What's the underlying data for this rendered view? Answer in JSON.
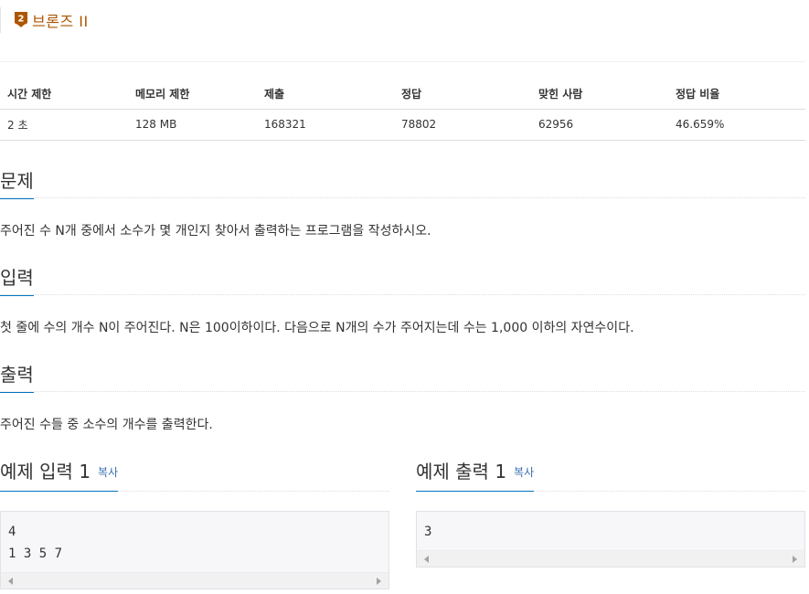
{
  "tier": {
    "number": "2",
    "label": "브론즈 II",
    "color": "#ad5600"
  },
  "info_table": {
    "headers": [
      "시간 제한",
      "메모리 제한",
      "제출",
      "정답",
      "맞힌 사람",
      "정답 비율"
    ],
    "values": [
      "2 초",
      "128 MB",
      "168321",
      "78802",
      "62956",
      "46.659%"
    ]
  },
  "sections": {
    "problem": {
      "title": "문제",
      "body": "주어진 수 N개 중에서 소수가 몇 개인지 찾아서 출력하는 프로그램을 작성하시오."
    },
    "input": {
      "title": "입력",
      "body": "첫 줄에 수의 개수 N이 주어진다. N은 100이하이다. 다음으로 N개의 수가 주어지는데 수는 1,000 이하의 자연수이다."
    },
    "output": {
      "title": "출력",
      "body": "주어진 수들 중 소수의 개수를 출력한다."
    }
  },
  "samples": {
    "input": {
      "title": "예제 입력 1",
      "copy": "복사",
      "text": "4\n1 3 5 7"
    },
    "output": {
      "title": "예제 출력 1",
      "copy": "복사",
      "text": "3"
    }
  },
  "colors": {
    "accent": "#0076c0",
    "link": "#3a6fb0",
    "tier": "#ad5600"
  },
  "icons": {
    "tier_badge": "bronze-shield-icon",
    "scroll_left": "scroll-left-arrow-icon",
    "scroll_right": "scroll-right-arrow-icon"
  }
}
